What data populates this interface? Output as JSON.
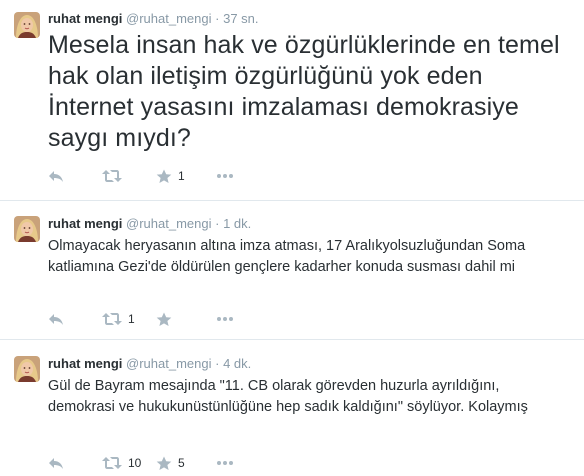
{
  "tweets": [
    {
      "fullname": "ruhat mengi",
      "username": "@ruhat_mengi",
      "separator": "·",
      "time": "37 sn.",
      "text": "Mesela insan hak ve özgürlüklerinde en temel hak olan iletişim özgürlüğünü yok eden İnternet yasasını imzalaması demokrasiye saygı mıydı?",
      "retweet_count": "",
      "favorite_count": "1"
    },
    {
      "fullname": "ruhat mengi",
      "username": "@ruhat_mengi",
      "separator": "·",
      "time": "1 dk.",
      "text": "Olmayacak heryasanın altına imza atması, 17 Aralıkyolsuzluğundan Soma katliamına Gezi'de öldürülen gençlere kadarher konuda susması dahil mi",
      "retweet_count": "1",
      "favorite_count": ""
    },
    {
      "fullname": "ruhat mengi",
      "username": "@ruhat_mengi",
      "separator": "·",
      "time": "4 dk.",
      "text": "Gül de Bayram mesajında \"11. CB olarak görevden huzurla ayrıldığını, demokrasi ve hukukunüstünlüğüne hep sadık kaldığını\" söylüyor. Kolaymış",
      "retweet_count": "10",
      "favorite_count": "5"
    }
  ],
  "icons": {
    "reply": "reply-icon",
    "retweet": "retweet-icon",
    "favorite": "star-icon",
    "more": "more-icon",
    "avatar": "avatar"
  },
  "colors": {
    "action_gray": "#aab8c2",
    "meta_gray": "#8899a6",
    "text": "#292f33",
    "divider": "#e1e8ed"
  }
}
